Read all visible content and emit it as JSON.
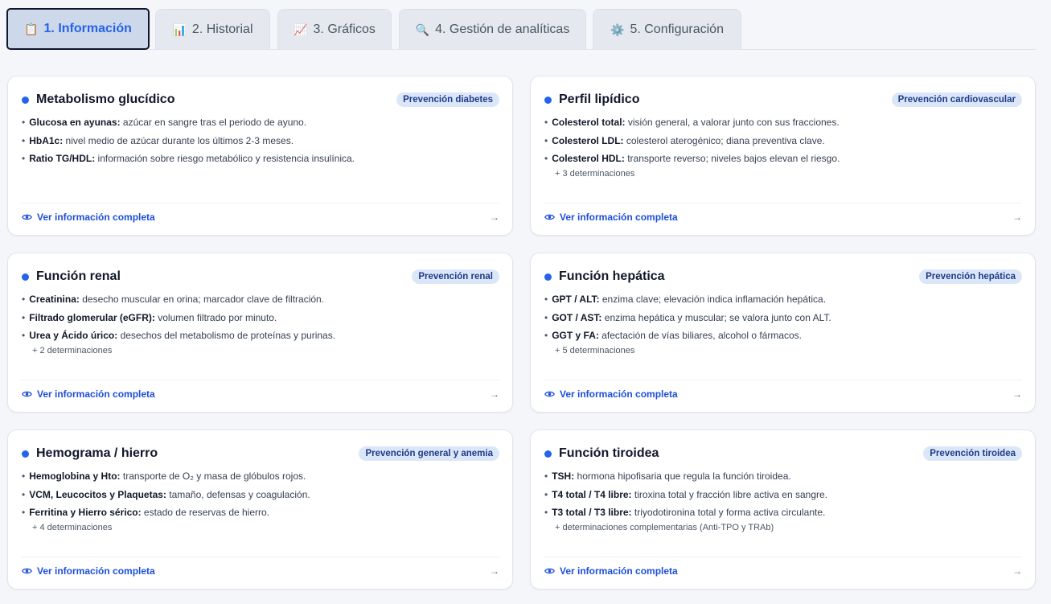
{
  "tabs": [
    {
      "icon": "📋",
      "label": "1. Información",
      "active": true
    },
    {
      "icon": "📊",
      "label": "2. Historial",
      "active": false
    },
    {
      "icon": "📈",
      "label": "3. Gráficos",
      "active": false
    },
    {
      "icon": "🔍",
      "label": "4. Gestión de analíticas",
      "active": false
    },
    {
      "icon": "⚙️",
      "label": "5. Configuración",
      "active": false
    }
  ],
  "cards": [
    {
      "title": "Metabolismo glucídico",
      "badge": "Prevención diabetes",
      "items": [
        {
          "term": "Glucosa en ayunas:",
          "desc": " azúcar en sangre tras el periodo de ayuno."
        },
        {
          "term": "HbA1c:",
          "desc": " nivel medio de azúcar durante los últimos 2-3 meses."
        },
        {
          "term": "Ratio TG/HDL:",
          "desc": " información sobre riesgo metabólico y resistencia insulínica."
        }
      ],
      "more": "",
      "link": "Ver información completa",
      "arrow": "→"
    },
    {
      "title": "Perfil lipídico",
      "badge": "Prevención cardiovascular",
      "items": [
        {
          "term": "Colesterol total:",
          "desc": " visión general, a valorar junto con sus fracciones."
        },
        {
          "term": "Colesterol LDL:",
          "desc": " colesterol aterogénico; diana preventiva clave."
        },
        {
          "term": "Colesterol HDL:",
          "desc": " transporte reverso; niveles bajos elevan el riesgo."
        }
      ],
      "more": "+ 3 determinaciones",
      "link": "Ver información completa",
      "arrow": "→"
    },
    {
      "title": "Función renal",
      "badge": "Prevención renal",
      "items": [
        {
          "term": "Creatinina:",
          "desc": " desecho muscular en orina; marcador clave de filtración."
        },
        {
          "term": "Filtrado glomerular (eGFR):",
          "desc": " volumen filtrado por minuto."
        },
        {
          "term": "Urea y Ácido úrico:",
          "desc": " desechos del metabolismo de proteínas y purinas."
        }
      ],
      "more": "+ 2 determinaciones",
      "link": "Ver información completa",
      "arrow": "→"
    },
    {
      "title": "Función hepática",
      "badge": "Prevención hepática",
      "items": [
        {
          "term": "GPT / ALT:",
          "desc": " enzima clave; elevación indica inflamación hepática."
        },
        {
          "term": "GOT / AST:",
          "desc": " enzima hepática y muscular; se valora junto con ALT."
        },
        {
          "term": "GGT y FA:",
          "desc": " afectación de vías biliares, alcohol o fármacos."
        }
      ],
      "more": "+ 5 determinaciones",
      "link": "Ver información completa",
      "arrow": "→"
    },
    {
      "title": "Hemograma / hierro",
      "badge": "Prevención general y anemia",
      "items": [
        {
          "term": "Hemoglobina y Hto:",
          "desc": " transporte de O₂ y masa de glóbulos rojos."
        },
        {
          "term": "VCM, Leucocitos y Plaquetas:",
          "desc": " tamaño, defensas y coagulación."
        },
        {
          "term": "Ferritina y Hierro sérico:",
          "desc": " estado de reservas de hierro."
        }
      ],
      "more": "+ 4 determinaciones",
      "link": "Ver información completa",
      "arrow": "→"
    },
    {
      "title": "Función tiroidea",
      "badge": "Prevención tiroidea",
      "items": [
        {
          "term": "TSH:",
          "desc": " hormona hipofisaria que regula la función tiroidea."
        },
        {
          "term": "T4 total / T4 libre:",
          "desc": " tiroxina total y fracción libre activa en sangre."
        },
        {
          "term": "T3 total / T3 libre:",
          "desc": " triyodotironina total y forma activa circulante."
        }
      ],
      "more": "+ determinaciones complementarias (Anti-TPO y TRAb)",
      "link": "Ver información completa",
      "arrow": "→"
    }
  ],
  "colors": {
    "accent": "#2563eb",
    "badge_bg": "#dbe7f8",
    "active_tab_bg": "#cdd9ea"
  },
  "icons": {
    "card_dot": "dot-icon",
    "link": "eye-icon",
    "arrow": "arrow-right-icon"
  }
}
